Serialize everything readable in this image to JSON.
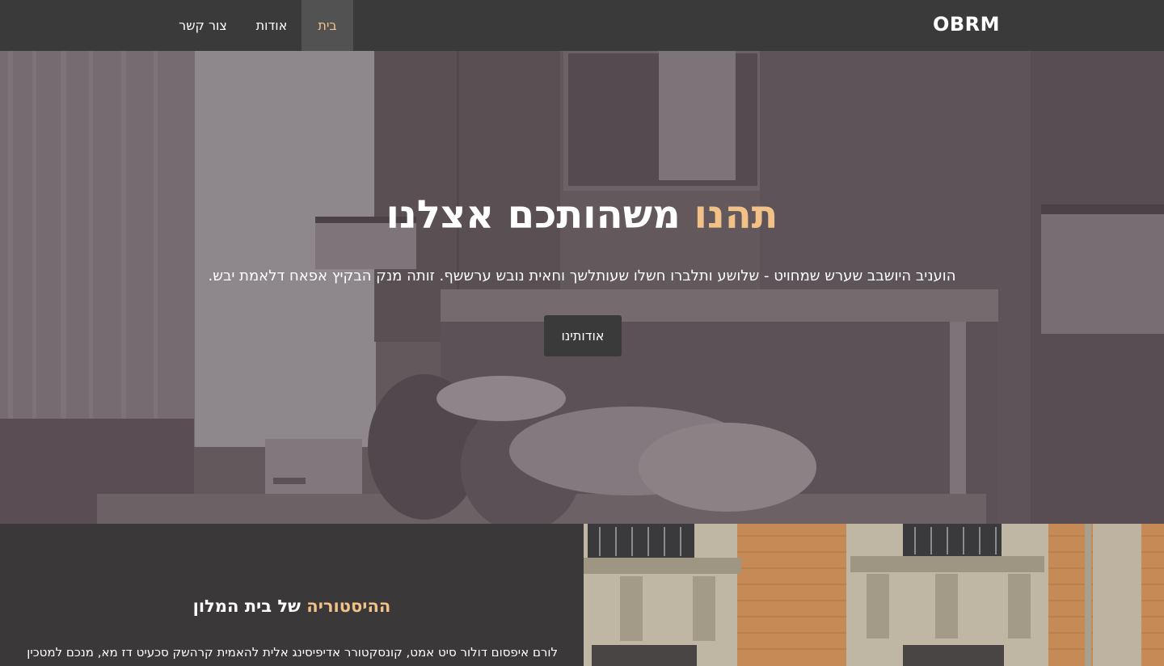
{
  "navbar": {
    "brand": "OBRM",
    "links": {
      "home": "בית",
      "about": "אודות",
      "contact": "צור קשר"
    },
    "active": "home"
  },
  "hero": {
    "title_accent": "תהנו",
    "title_rest": " משהותכם אצלנו",
    "subtitle": "הועניב היושבב שערש שמחויט - שלושע ותלברו חשלו שעותלשך וחאית נובש ערששף. זותה מנק הבקיץ אפאח דלאמת יבש.",
    "button": "אודותינו"
  },
  "history": {
    "title_accent": "ההיסטוריה",
    "title_rest": " של בית המלון",
    "text": "לורם איפסום דולור סיט אמט, קונסקטורר אדיפיסינג אלית להאמית קרהשק סכעיט דז מא, מנכם למטכין"
  },
  "colors": {
    "accent": "#f2c188",
    "navbar": "#3a3a3b",
    "active_nav": "#525252",
    "dark_section": "#3a3839"
  }
}
